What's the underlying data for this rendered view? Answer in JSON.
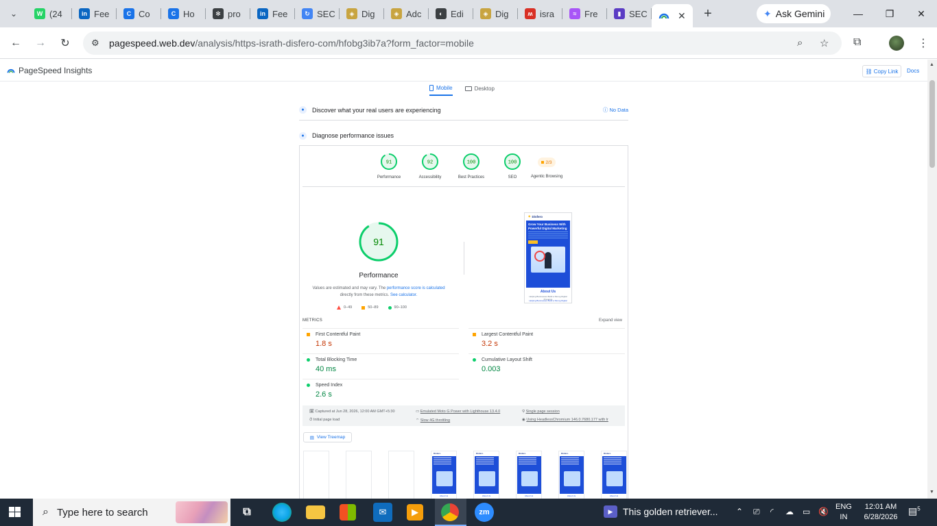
{
  "browser": {
    "tabs": [
      {
        "title": "(24",
        "icon": "whatsapp-icon",
        "color": "#25d366",
        "glyph": "W"
      },
      {
        "title": "Fee",
        "icon": "linkedin-icon",
        "color": "#0a66c2",
        "glyph": "in"
      },
      {
        "title": "Co",
        "icon": "copilot-icon",
        "color": "#1a73e8",
        "glyph": "C"
      },
      {
        "title": "Ho",
        "icon": "copilot-icon",
        "color": "#1a73e8",
        "glyph": "C"
      },
      {
        "title": "pro",
        "icon": "openai-icon",
        "color": "#3c4043",
        "glyph": "✻"
      },
      {
        "title": "Fee",
        "icon": "linkedin-icon",
        "color": "#0a66c2",
        "glyph": "in"
      },
      {
        "title": "SEC",
        "icon": "sync-icon",
        "color": "#4285f4",
        "glyph": "↻"
      },
      {
        "title": "Dig",
        "icon": "shield-icon",
        "color": "#c8a440",
        "glyph": "◈"
      },
      {
        "title": "Adc",
        "icon": "shield-icon",
        "color": "#c8a440",
        "glyph": "◈"
      },
      {
        "title": "Edi",
        "icon": "globe-icon",
        "color": "#3c4043",
        "glyph": "◐"
      },
      {
        "title": "Dig",
        "icon": "shield-icon",
        "color": "#c8a440",
        "glyph": "◈"
      },
      {
        "title": "isra",
        "icon": "pulse-icon",
        "color": "#d93025",
        "glyph": "ʍ"
      },
      {
        "title": "Fre",
        "icon": "feather-icon",
        "color": "#a855f7",
        "glyph": "≈"
      },
      {
        "title": "SEC",
        "icon": "chart-icon",
        "color": "#5b3cc4",
        "glyph": "▮"
      }
    ],
    "active_tab_icon": "pagespeed-icon",
    "gemini_label": "Ask Gemini",
    "url_host": "pagespeed.web.dev",
    "url_path": "/analysis/https-israth-disfero-com/hfobg3ib7a?form_factor=mobile"
  },
  "psi": {
    "brand": "PageSpeed Insights",
    "copy_link": "Copy Link",
    "docs": "Docs",
    "tab_mobile": "Mobile",
    "tab_desktop": "Desktop",
    "discover": "Discover what your real users are experiencing",
    "no_data": "No Data",
    "diagnose": "Diagnose performance issues",
    "categories": [
      {
        "label": "Performance",
        "score": "91",
        "fraction": 0.91
      },
      {
        "label": "Accessibility",
        "score": "92",
        "fraction": 0.92
      },
      {
        "label": "Best Practices",
        "score": "100",
        "fraction": 1.0
      },
      {
        "label": "SEO",
        "score": "100",
        "fraction": 1.0
      }
    ],
    "agentic": {
      "label": "Agentic Browsing",
      "value": "2/3"
    },
    "main_score": "91",
    "main_fraction": 0.91,
    "main_label": "Performance",
    "disclaimer_pre": "Values are estimated and may vary. The ",
    "disclaimer_link1": "performance score is calculated",
    "disclaimer_mid": " directly from these metrics. ",
    "disclaimer_link2": "See calculator.",
    "legend": {
      "bad": "0–49",
      "avg": "50–89",
      "good": "90–100"
    },
    "screenshot": {
      "brand": "Disfero",
      "headline": "Grow Your Business With Powerful Digital Marketing",
      "about": "About Us",
      "sub": "Helping Businesses Build a Strong Digital Presence",
      "sub2": "Helping Businesses Build a Strong Digital"
    },
    "metrics_title": "METRICS",
    "expand_view": "Expand view",
    "metrics": [
      {
        "name": "First Contentful Paint",
        "value": "1.8 s",
        "rating": "avg"
      },
      {
        "name": "Largest Contentful Paint",
        "value": "3.2 s",
        "rating": "avg"
      },
      {
        "name": "Total Blocking Time",
        "value": "40 ms",
        "rating": "good"
      },
      {
        "name": "Cumulative Layout Shift",
        "value": "0.003",
        "rating": "good"
      },
      {
        "name": "Speed Index",
        "value": "2.6 s",
        "rating": "good"
      }
    ],
    "env": {
      "captured": "Captured at Jun 28, 2026, 12:00 AM GMT+5:30",
      "initial": "Initial page load",
      "device": "Emulated Moto G Power with Lighthouse 13.4.0",
      "throttle": "Slow 4G throttling",
      "session": "Single page session",
      "browser": "Using HeadlessChromium 146.0.7680.177 with lr"
    },
    "treemap": "View Treemap",
    "filmstrip_labels": [
      "About Us",
      "About Us",
      "About Us",
      "About Us",
      "About Us"
    ]
  },
  "taskbar": {
    "search_placeholder": "Type here to search",
    "news": "This golden retriever...",
    "lang1": "ENG",
    "lang2": "IN",
    "time": "12:01 AM",
    "date": "6/28/2026",
    "notif_count": "5"
  },
  "colors": {
    "good": "#0cce6b",
    "avg": "#ffa400",
    "bad": "#ff4e42",
    "accent": "#1a73e8"
  }
}
